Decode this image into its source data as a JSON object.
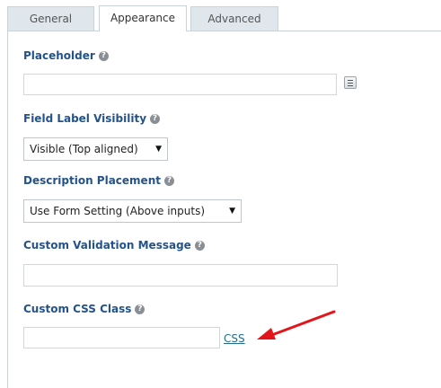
{
  "tabs": [
    {
      "label": "General"
    },
    {
      "label": "Appearance"
    },
    {
      "label": "Advanced"
    }
  ],
  "fields": {
    "placeholder": {
      "label": "Placeholder",
      "value": ""
    },
    "field_label_visibility": {
      "label": "Field Label Visibility",
      "selected": "Visible (Top aligned)"
    },
    "description_placement": {
      "label": "Description Placement",
      "selected": "Use Form Setting (Above inputs)"
    },
    "custom_validation_message": {
      "label": "Custom Validation Message",
      "value": ""
    },
    "custom_css_class": {
      "label": "Custom CSS Class",
      "value": "",
      "link": "CSS"
    }
  },
  "help_glyph": "?",
  "colors": {
    "label": "#23538a",
    "link": "#236c8e",
    "tab_inactive_bg": "#dfe7ed",
    "annotation_arrow": "#e3151a"
  },
  "icons": [
    "help-icon",
    "merge-tag-icon",
    "caret-down-icon",
    "annotation-arrow"
  ]
}
